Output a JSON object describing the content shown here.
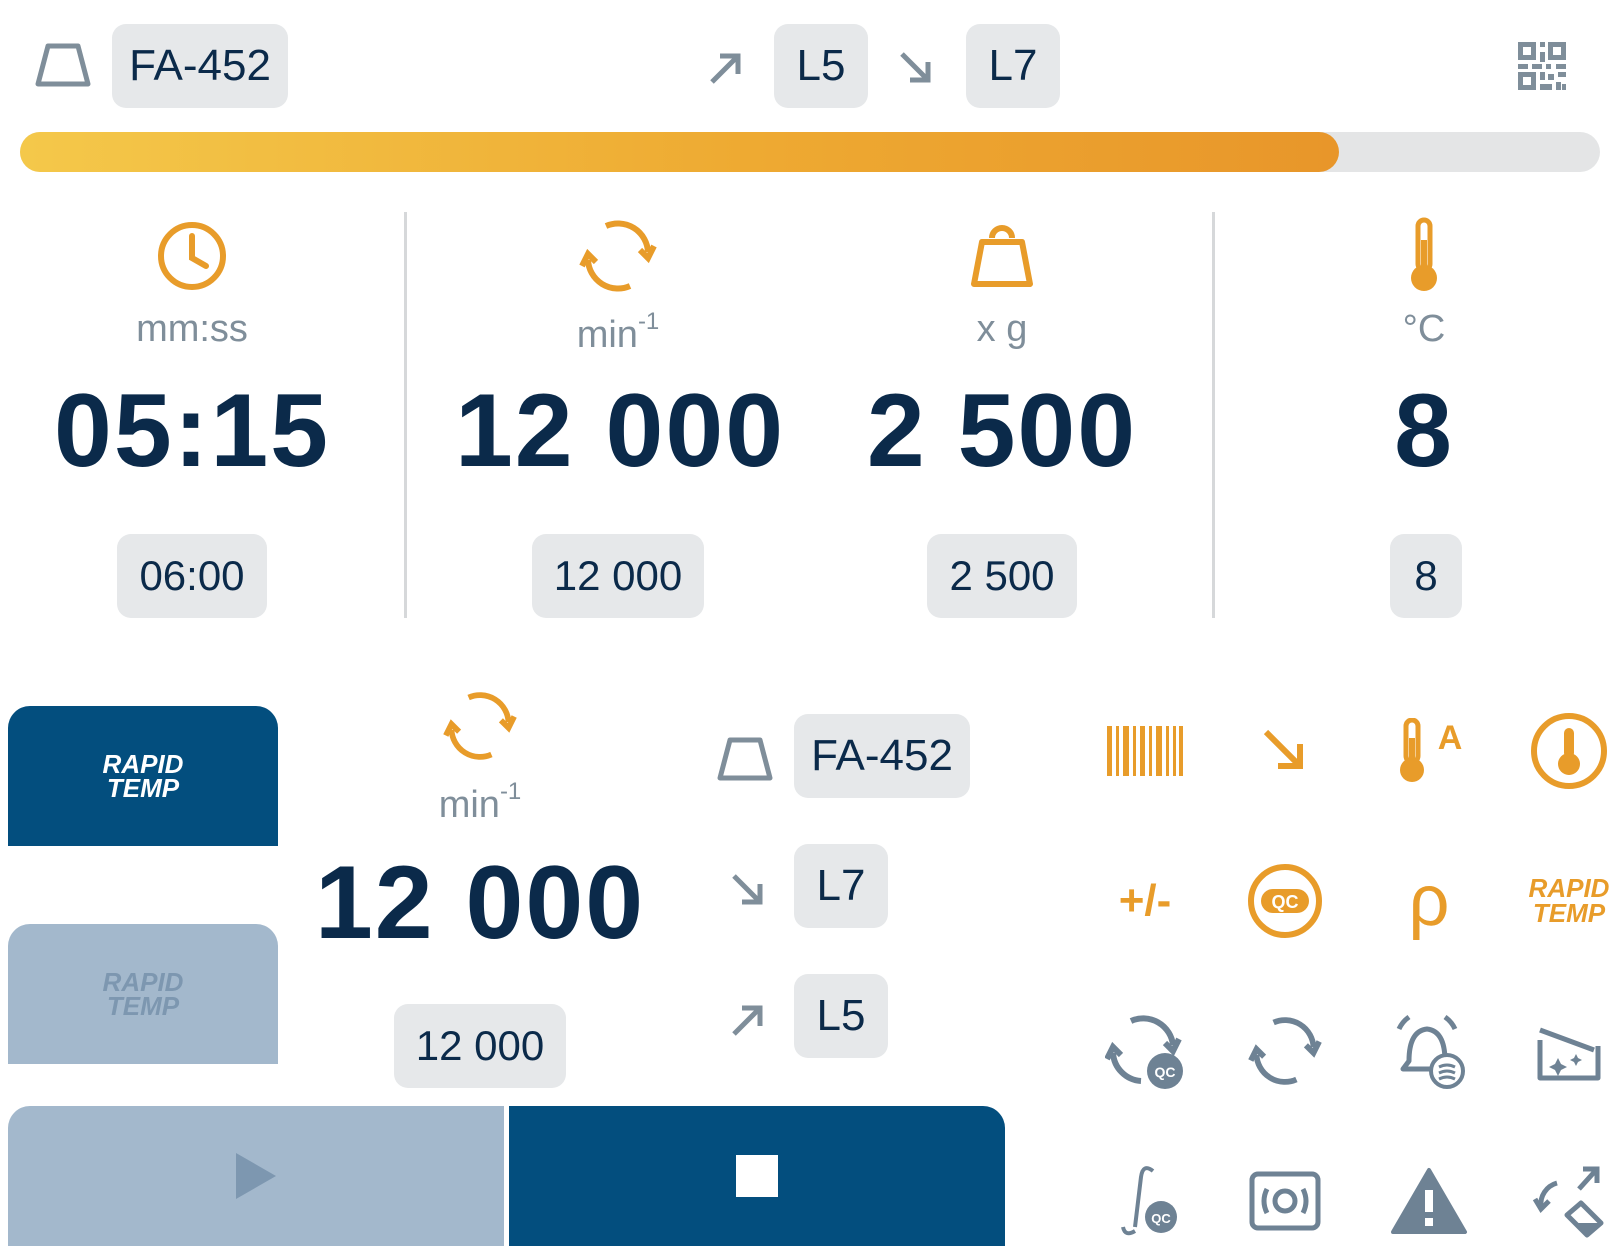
{
  "header": {
    "rotor_id": "FA-452",
    "accel_level": "L5",
    "decel_level": "L7"
  },
  "progress": {
    "fraction": 0.835
  },
  "parameters": {
    "time": {
      "unit": "mm:ss",
      "actual": "05:15",
      "setpoint": "06:00"
    },
    "speed": {
      "unit": "min",
      "unit_sup": "-1",
      "actual": "12 000",
      "setpoint": "12 000"
    },
    "rcf": {
      "unit": "x g",
      "actual": "2 500",
      "setpoint": "2 500"
    },
    "temp": {
      "unit": "°C",
      "actual": "8",
      "setpoint": "8"
    }
  },
  "lower": {
    "rapid_temp_active": {
      "line1": "RAPID",
      "line2": "TEMP"
    },
    "rapid_temp_inactive": {
      "line1": "RAPID",
      "line2": "TEMP"
    },
    "speed": {
      "unit": "min",
      "unit_sup": "-1",
      "actual": "12 000",
      "setpoint": "12 000"
    },
    "rotor_id": "FA-452",
    "decel_level": "L7",
    "accel_level": "L5"
  },
  "icon_grid": {
    "plusminus_text": "+/-",
    "rho_text": "ρ",
    "temp_a_text": "A",
    "qc_text": "QC",
    "rapid_line1": "RAPID",
    "rapid_line2": "TEMP"
  },
  "colors": {
    "navy": "#0b2a4a",
    "primary_blue": "#034e7e",
    "disabled_blue": "#a3b8cc",
    "accent_orange": "#e89c2a",
    "icon_gray": "#6e8294",
    "chip_bg": "#e6e8ea"
  },
  "icons": [
    "rotor-icon",
    "accel-arrow-icon",
    "decel-arrow-icon",
    "qr-code-icon",
    "clock-icon",
    "rotation-icon",
    "weight-icon",
    "thermometer-icon",
    "play-icon",
    "stop-icon",
    "barcode-icon",
    "temp-auto-icon",
    "temp-circle-icon",
    "qc-icon",
    "rotation-qc-icon",
    "alarm-bell-icon",
    "cleaning-icon",
    "integral-qc-icon",
    "imbalance-icon",
    "warning-icon",
    "rotate-tilt-icon"
  ]
}
